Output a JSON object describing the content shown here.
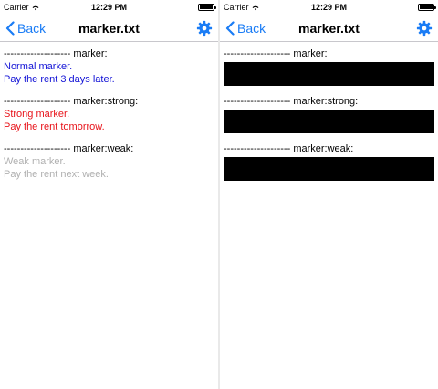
{
  "status_bar": {
    "carrier": "Carrier",
    "time": "12:29 PM",
    "battery_level": 0.95
  },
  "navbar": {
    "back_label": "Back",
    "title": "marker.txt"
  },
  "left": {
    "sections": [
      {
        "heading": "-------------------- marker:",
        "lines": [
          "Normal marker.",
          "Pay the rent 3 days later."
        ]
      },
      {
        "heading": "-------------------- marker:strong:",
        "lines": [
          "Strong marker.",
          "Pay the rent tomorrow."
        ]
      },
      {
        "heading": "-------------------- marker:weak:",
        "lines": [
          "Weak marker.",
          "Pay the rent next week."
        ]
      }
    ]
  },
  "right": {
    "sections": [
      {
        "heading": "-------------------- marker:"
      },
      {
        "heading": "-------------------- marker:strong:"
      },
      {
        "heading": "-------------------- marker:weak:"
      }
    ]
  },
  "colors": {
    "accent": "#1a7cf5",
    "normal": "#1212d6",
    "strong": "#e8131a",
    "weak": "#b0b0b0",
    "redaction": "#000000"
  }
}
